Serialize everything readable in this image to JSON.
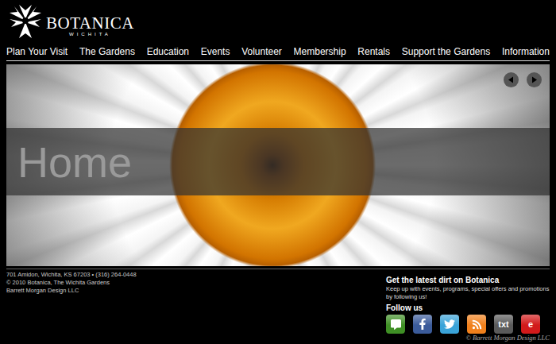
{
  "logo": {
    "name": "BOTANICA",
    "city": "WICHITA"
  },
  "nav": [
    "Plan Your Visit",
    "The Gardens",
    "Education",
    "Events",
    "Volunteer",
    "Membership",
    "Rentals",
    "Support the Gardens",
    "Information"
  ],
  "hero": {
    "caption": "Home"
  },
  "footer": {
    "address": "701 Amidon, Wichita, KS 67203 • (316) 264-0448",
    "copyright": "© 2010 Botanica, The Wichita Gardens",
    "credit": "Barrett Morgan Design LLC"
  },
  "social": {
    "title": "Get the latest dirt on Botanica",
    "description": "Keep up with events, programs, special offers and promotions by following us!",
    "follow_label": "Follow us",
    "icons": [
      {
        "kind": "chat",
        "color": "#3f8f25"
      },
      {
        "kind": "facebook",
        "color": "#3b5b9a"
      },
      {
        "kind": "twitter",
        "color": "#3aa3d8"
      },
      {
        "kind": "rss",
        "color": "#f0801c"
      },
      {
        "kind": "txt",
        "label": "txt",
        "color": "#5a5a5a"
      },
      {
        "kind": "email",
        "label": "e",
        "color": "#d21a1a"
      }
    ]
  },
  "watermark": "© Barrett Morgan Design LLC"
}
